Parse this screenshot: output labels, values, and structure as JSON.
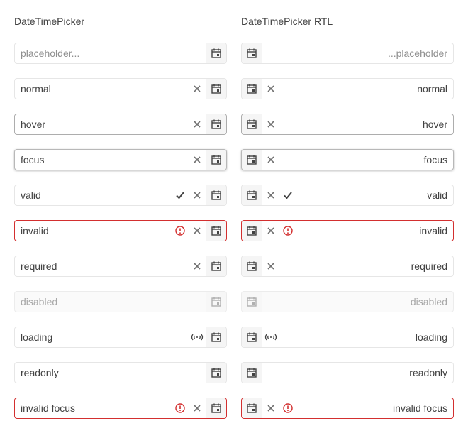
{
  "columns": {
    "ltr_title": "DateTimePicker",
    "rtl_title": "DateTimePicker RTL"
  },
  "colors": {
    "border": "#e6e6e6",
    "hover_border": "#adadad",
    "invalid_border": "#d32f2f",
    "text": "#424242",
    "placeholder_text": "#8f8f8f",
    "disabled_text": "#a8a8a8",
    "button_bg": "#f5f5f5"
  },
  "icons": {
    "calendar": "calendar-icon",
    "clear": "x-icon",
    "valid": "check-icon",
    "invalid": "exclamation-circle-icon",
    "loading": "loading-icon"
  },
  "ltr": {
    "placeholder": "placeholder...",
    "normal": "normal",
    "hover": "hover",
    "focus": "focus",
    "valid": "valid",
    "invalid": "invalid",
    "required": "required",
    "disabled": "disabled",
    "loading": "loading",
    "readonly": "readonly",
    "invalid_focus": "invalid focus"
  },
  "rtl": {
    "placeholder": "...placeholder",
    "normal": "normal",
    "hover": "hover",
    "focus": "focus",
    "valid": "valid",
    "invalid": "invalid",
    "required": "required",
    "disabled": "disabled",
    "loading": "loading",
    "readonly": "readonly",
    "invalid_focus": "invalid focus"
  }
}
